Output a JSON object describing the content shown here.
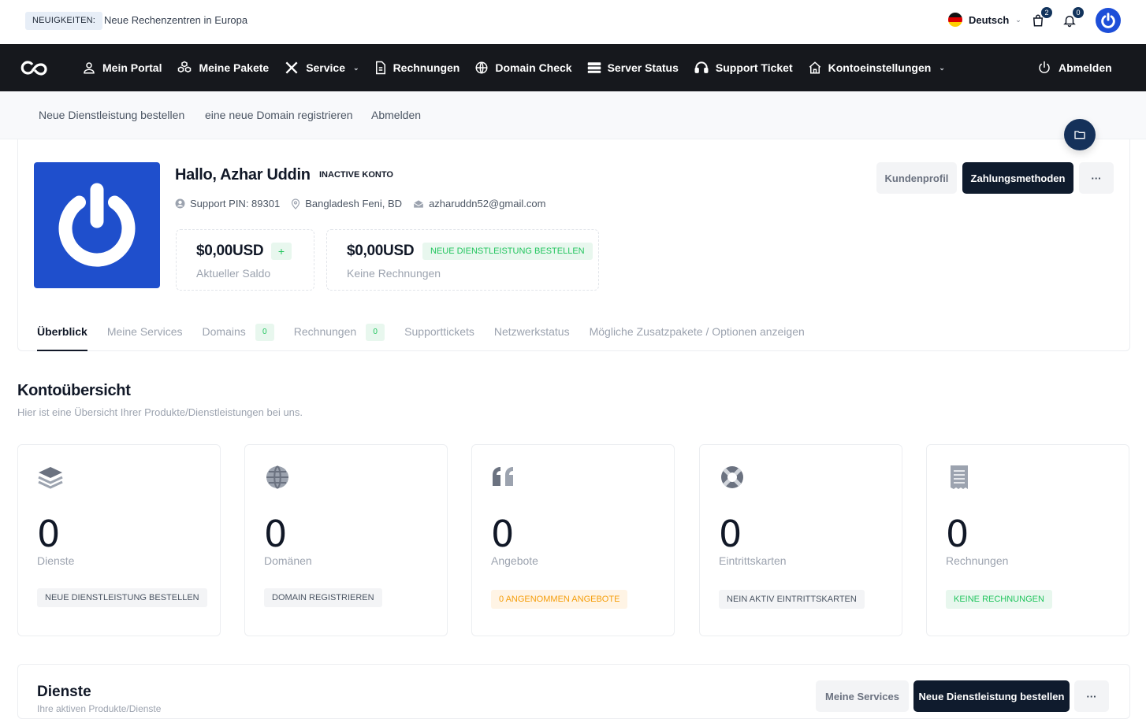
{
  "topbar": {
    "news_badge": "NEUIGKEITEN:",
    "news_text": "Neue Rechenzentren in Europa",
    "language": "Deutsch",
    "cart_count": "2",
    "notifications_count": "0"
  },
  "nav": {
    "items": [
      {
        "label": "Mein Portal",
        "icon": "user-icon"
      },
      {
        "label": "Meine Pakete",
        "icon": "boxes-icon"
      },
      {
        "label": "Service",
        "icon": "tools-icon"
      },
      {
        "label": "Rechnungen",
        "icon": "document-icon"
      },
      {
        "label": "Domain Check",
        "icon": "globe-icon"
      },
      {
        "label": "Server Status",
        "icon": "server-icon"
      },
      {
        "label": "Support Ticket",
        "icon": "headset-icon"
      },
      {
        "label": "Kontoeinstellungen",
        "icon": "home-icon"
      }
    ],
    "logout": "Abmelden"
  },
  "subnav": {
    "items": [
      "Neue Dienstleistung bestellen",
      "eine neue Domain registrieren",
      "Abmelden"
    ]
  },
  "profile": {
    "greeting": "Hallo, Azhar Uddin",
    "status": "INACTIVE KONTO",
    "support_pin": "Support PIN: 89301",
    "location": "Bangladesh Feni, BD",
    "email": "azharuddn52@gmail.com",
    "balance_amount": "$0,00USD",
    "balance_label": "Aktueller Saldo",
    "balance_add": "+",
    "invoices_amount": "$0,00USD",
    "invoices_badge": "NEUE DIENSTLEISTUNG BESTELLEN",
    "invoices_label": "Keine Rechnungen",
    "btn_profile": "Kundenprofil",
    "btn_payment": "Zahlungsmethoden",
    "btn_more": "···"
  },
  "tabs": [
    {
      "label": "Überblick",
      "count": null
    },
    {
      "label": "Meine Services",
      "count": null
    },
    {
      "label": "Domains",
      "count": "0"
    },
    {
      "label": "Rechnungen",
      "count": "0"
    },
    {
      "label": "Supporttickets",
      "count": null
    },
    {
      "label": "Netzwerkstatus",
      "count": null
    },
    {
      "label": "Mögliche Zusatzpakete / Optionen anzeigen",
      "count": null
    }
  ],
  "overview": {
    "title": "Kontoübersicht",
    "subtitle": "Hier ist eine Übersicht Ihrer Produkte/Dienstleistungen bei uns.",
    "cards": [
      {
        "value": "0",
        "label": "Dienste",
        "badge": "NEUE DIENSTLEISTUNG BESTELLEN",
        "icon": "layers-icon"
      },
      {
        "value": "0",
        "label": "Domänen",
        "badge": "DOMAIN REGISTRIEREN",
        "icon": "globe-icon"
      },
      {
        "value": "0",
        "label": "Angebote",
        "badge": "0 ANGENOMMEN ANGEBOTE",
        "icon": "quote-icon"
      },
      {
        "value": "0",
        "label": "Eintrittskarten",
        "badge": "NEIN AKTIV EINTRITTSKARTEN",
        "icon": "lifebuoy-icon"
      },
      {
        "value": "0",
        "label": "Rechnungen",
        "badge": "KEINE RECHNUNGEN",
        "icon": "receipt-icon"
      }
    ]
  },
  "services": {
    "title": "Dienste",
    "subtitle": "Ihre aktiven Produkte/Dienste",
    "btn_my_services": "Meine Services",
    "btn_order": "Neue Dienstleistung bestellen",
    "btn_more": "···"
  },
  "colors": {
    "navbar": "#16181d",
    "accent": "#1f4fcc",
    "dark_button": "#0f1b2d",
    "success": "#22c55e",
    "warning": "#f59e0b"
  }
}
